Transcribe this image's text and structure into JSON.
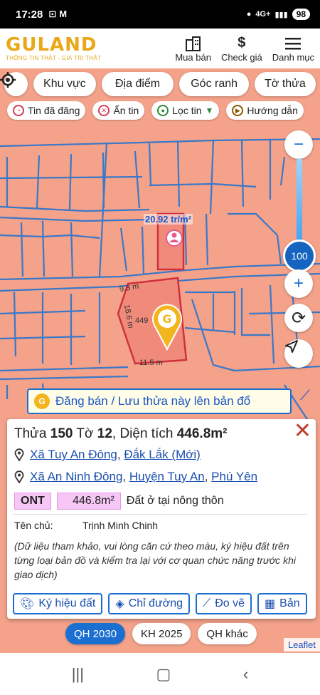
{
  "status_bar": {
    "time": "17:28",
    "signal": "4G+",
    "battery": "98"
  },
  "header": {
    "logo": "GULAND",
    "tagline": "THÔNG TIN THẬT - GIÁ TRỊ THẬT",
    "nav": [
      {
        "label": "Mua bán",
        "icon": "building-icon"
      },
      {
        "label": "Check giá",
        "icon": "dollar-icon"
      },
      {
        "label": "Danh mục",
        "icon": "menu-icon"
      }
    ]
  },
  "filters": [
    "Khu vực",
    "Địa điểm",
    "Góc ranh",
    "Tờ thửa"
  ],
  "chips": [
    "Tin đã đăng",
    "Ẩn tin",
    "Lọc tin",
    "Hướng dẫn"
  ],
  "zoom": {
    "value": "100"
  },
  "map": {
    "price_label": "20.92 tr/m²",
    "dims": [
      "9.3 m",
      "18.6 m",
      "449",
      "11.5 m"
    ],
    "post_button": "Đăng bán / Lưu thửa này lên bản đổ"
  },
  "parcel": {
    "thua_label": "Thửa",
    "thua_no": "150",
    "to_label": "Tờ",
    "to_no": "12",
    "area_label": "Diện tích",
    "area": "446.8m²",
    "addr_new": {
      "ward": "Xã Tuy An Đông",
      "province": "Đắk Lắk (Mới)"
    },
    "addr_old": {
      "ward": "Xã An Ninh Đông",
      "district": "Huyện Tuy An",
      "province": "Phú Yên"
    },
    "land_code": "ONT",
    "land_area": "446.8m²",
    "land_desc": "Đất ở tại nông thôn",
    "owner_label": "Tên chủ:",
    "owner": "Trịnh Minh Chinh",
    "note": "(Dữ liệu tham khảo, vui lòng căn cứ theo màu, ký hiệu đất trên từng loại bản đồ và kiểm tra lại với cơ quan chức năng trước khi giao dịch)"
  },
  "actions": [
    "Ký hiệu đất",
    "Chỉ đường",
    "Đo vẽ",
    "Bản"
  ],
  "plans": [
    "QH 2030",
    "KH 2025",
    "QH khác"
  ],
  "attribution": "Leaflet",
  "colors": {
    "accent": "#1a6fd1",
    "brand": "#e8a818",
    "map_fill": "#f4a28a",
    "road": "#3a78c8"
  }
}
